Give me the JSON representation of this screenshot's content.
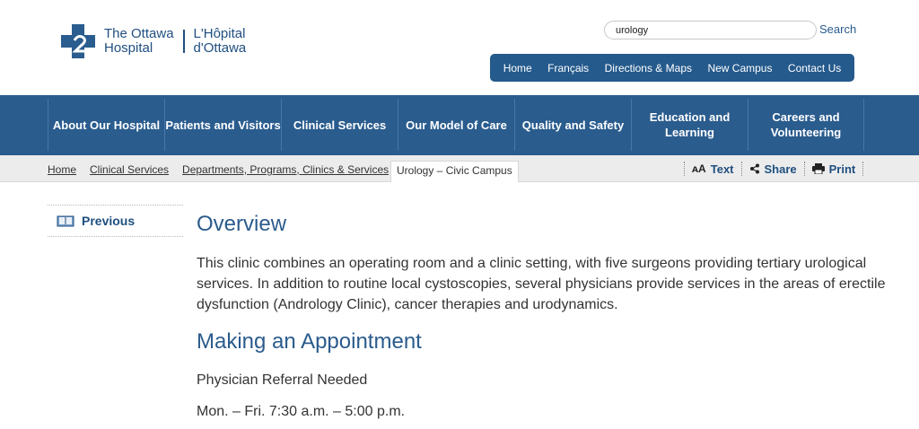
{
  "header": {
    "logo_en": "The Ottawa\nHospital",
    "logo_fr": "L'Hôpital\nd'Ottawa",
    "search": {
      "value": "urology",
      "button": "Search"
    },
    "utility_nav": [
      "Home",
      "Français",
      "Directions & Maps",
      "New Campus",
      "Contact Us"
    ]
  },
  "main_nav": [
    "About Our Hospital",
    "Patients and Visitors",
    "Clinical Services",
    "Our Model of Care",
    "Quality and Safety",
    "Education and Learning",
    "Careers and Volunteering"
  ],
  "breadcrumb": {
    "items": [
      "Home",
      "Clinical Services",
      "Departments, Programs, Clinics & Services"
    ],
    "current": "Urology – Civic Campus"
  },
  "tools": {
    "text": "Text",
    "share": "Share",
    "print": "Print"
  },
  "sidebar": {
    "previous": "Previous"
  },
  "content": {
    "overview_title": "Overview",
    "overview_text": "This clinic combines an operating room and a clinic setting, with five surgeons providing tertiary urological services. In addition to routine local cystoscopies, several physicians provide services in the areas of erectile dysfunction (Andrology Clinic), cancer therapies and urodynamics.",
    "appointment_title": "Making an Appointment",
    "referral": "Physician Referral Needed",
    "hours": "Mon. – Fri. 7:30 a.m. – 5:00 p.m."
  },
  "colors": {
    "brand_blue": "#2a5c8e",
    "link_blue": "#2b5b8c"
  }
}
